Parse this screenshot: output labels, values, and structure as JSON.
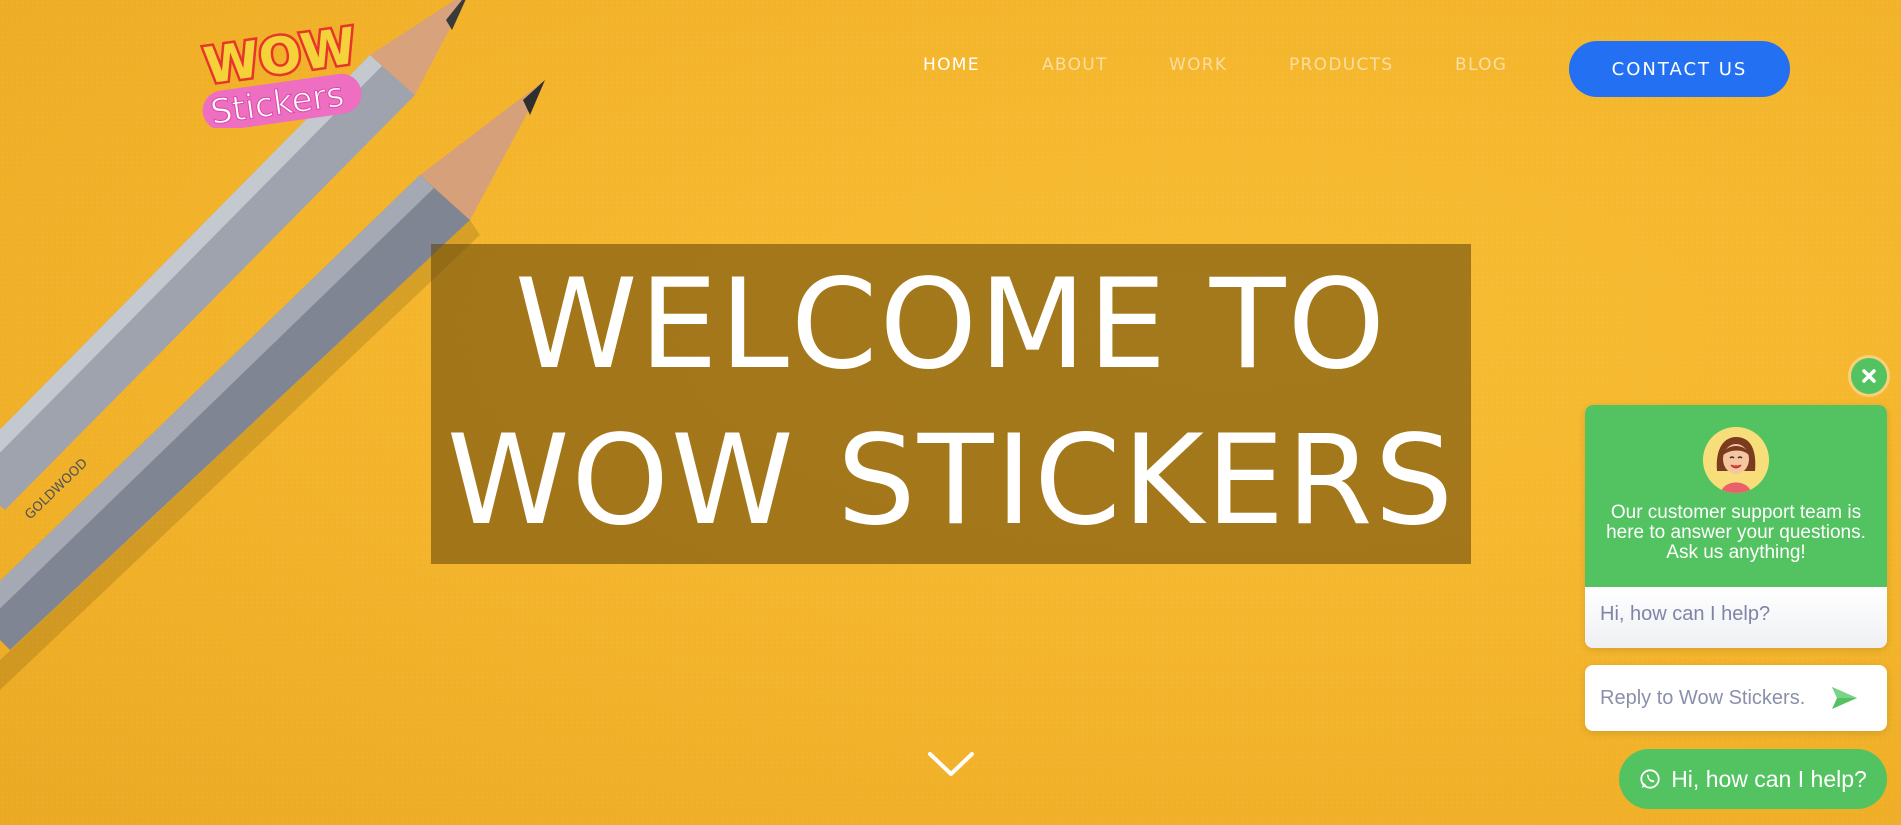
{
  "brand": {
    "logo_line1": "WOW",
    "logo_line2": "Stickers"
  },
  "nav": {
    "items": [
      {
        "label": "HOME",
        "active": true
      },
      {
        "label": "ABOUT",
        "active": false
      },
      {
        "label": "WORK",
        "active": false
      },
      {
        "label": "PRODUCTS",
        "active": false
      },
      {
        "label": "BLOG",
        "active": false
      }
    ],
    "contact_label": "CONTACT US"
  },
  "hero": {
    "title_line1": "WELCOME TO",
    "title_line2": "WOW STICKERS",
    "background_color": "#f4b62c"
  },
  "chat": {
    "intro": "Our customer support team is here to answer your questions. Ask us anything!",
    "greeting": "Hi, how can I help?",
    "reply_placeholder": "Reply to Wow Stickers.",
    "launcher_label": "Hi, how can I help?",
    "accent_color": "#53c260"
  },
  "colors": {
    "primary_button": "#2370f2",
    "chat_green": "#53c260"
  },
  "icons": {
    "close": "close-icon",
    "send": "send-icon",
    "whatsapp": "whatsapp-icon",
    "scroll": "chevron-down-icon"
  }
}
